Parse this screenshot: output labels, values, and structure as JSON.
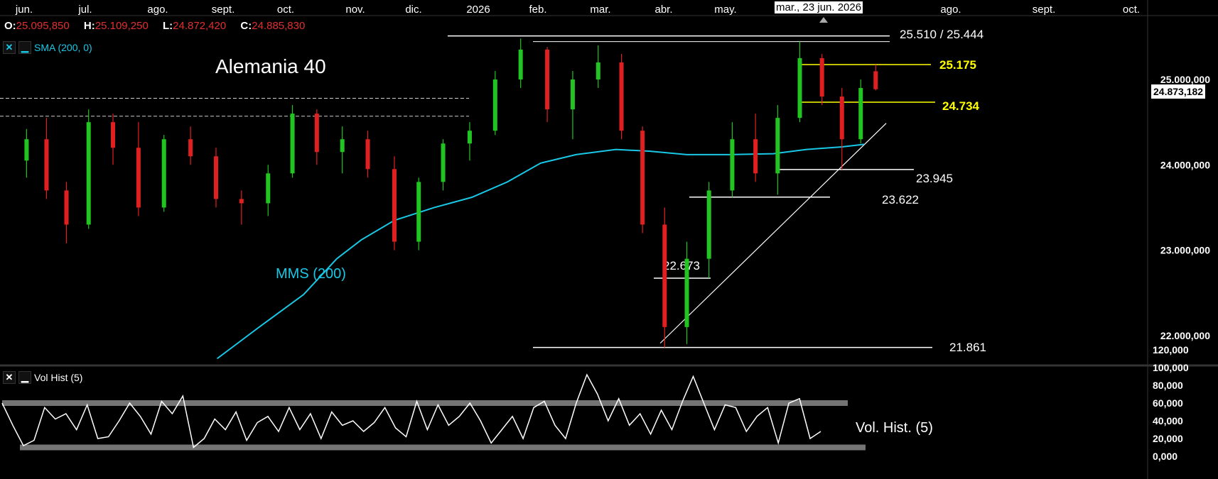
{
  "ohlc": {
    "o_label": "O:",
    "o_value": "25.095,850",
    "h_label": "H:",
    "h_value": "25.109,250",
    "l_label": "L:",
    "l_value": "24.872,420",
    "c_label": "C:",
    "c_value": "24.885,830"
  },
  "sma_legend": {
    "close_glyph": "✕",
    "minimize_glyph": "▁",
    "label": "SMA (200, 0)"
  },
  "vol_legend": {
    "close_glyph": "✕",
    "minimize_glyph": "▁",
    "label": "Vol Hist (5)"
  },
  "crosshair_date": "mar., 23 jun. 2026",
  "last_price": "24.873,182",
  "colors": {
    "up": "#22c422",
    "down": "#e02020",
    "sma": "#19c8e6",
    "level_yellow": "#ffff00",
    "background": "#000000",
    "volatility": "#ffffff"
  },
  "chart_data": [
    {
      "type": "candlestick",
      "title": "Alemania 40",
      "x_ticks": [
        "jun.",
        "jul.",
        "ago.",
        "sept.",
        "oct.",
        "nov.",
        "dic.",
        "2026",
        "feb.",
        "mar.",
        "abr.",
        "may.",
        "mar., 23 jun. 2026",
        "ago.",
        "sept.",
        "oct."
      ],
      "y_ticks": [
        "25.000,000",
        "24.000,000",
        "23.000,000",
        "22.000,000"
      ],
      "ylim": [
        21800,
        25600
      ],
      "series": [
        {
          "name": "SMA (200, 0)",
          "label": "MMS (200)",
          "points": [
            {
              "x": "2025-09-01",
              "y": 21730
            },
            {
              "x": "2025-09-20",
              "y": 22100
            },
            {
              "x": "2025-10-10",
              "y": 22480
            },
            {
              "x": "2025-10-25",
              "y": 22900
            },
            {
              "x": "2025-11-05",
              "y": 23120
            },
            {
              "x": "2025-11-20",
              "y": 23350
            },
            {
              "x": "2025-12-08",
              "y": 23500
            },
            {
              "x": "2025-12-25",
              "y": 23620
            },
            {
              "x": "2026-01-10",
              "y": 23800
            },
            {
              "x": "2026-01-25",
              "y": 24020
            },
            {
              "x": "2026-02-10",
              "y": 24120
            },
            {
              "x": "2026-02-28",
              "y": 24180
            },
            {
              "x": "2026-03-15",
              "y": 24160
            },
            {
              "x": "2026-04-01",
              "y": 24120
            },
            {
              "x": "2026-04-20",
              "y": 24120
            },
            {
              "x": "2026-05-10",
              "y": 24130
            },
            {
              "x": "2026-05-25",
              "y": 24180
            },
            {
              "x": "2026-06-10",
              "y": 24210
            },
            {
              "x": "2026-06-20",
              "y": 24240
            }
          ]
        }
      ],
      "candles": [
        {
          "x": "2025-06-02",
          "o": 24050,
          "h": 24420,
          "l": 23850,
          "c": 24300
        },
        {
          "x": "2025-06-12",
          "o": 24300,
          "h": 24550,
          "l": 23600,
          "c": 23700
        },
        {
          "x": "2025-06-20",
          "o": 23700,
          "h": 23800,
          "l": 23080,
          "c": 23300
        },
        {
          "x": "2025-06-30",
          "o": 23300,
          "h": 24650,
          "l": 23250,
          "c": 24500
        },
        {
          "x": "2025-07-10",
          "o": 24500,
          "h": 24600,
          "l": 24000,
          "c": 24200
        },
        {
          "x": "2025-07-22",
          "o": 24200,
          "h": 24500,
          "l": 23400,
          "c": 23500
        },
        {
          "x": "2025-08-02",
          "o": 23500,
          "h": 24350,
          "l": 23450,
          "c": 24300
        },
        {
          "x": "2025-08-14",
          "o": 24300,
          "h": 24450,
          "l": 24000,
          "c": 24100
        },
        {
          "x": "2025-08-26",
          "o": 24100,
          "h": 24200,
          "l": 23500,
          "c": 23600
        },
        {
          "x": "2025-09-06",
          "o": 23600,
          "h": 23700,
          "l": 23300,
          "c": 23550
        },
        {
          "x": "2025-09-18",
          "o": 23550,
          "h": 24000,
          "l": 23400,
          "c": 23900
        },
        {
          "x": "2025-09-30",
          "o": 23900,
          "h": 24700,
          "l": 23850,
          "c": 24600
        },
        {
          "x": "2025-10-10",
          "o": 24600,
          "h": 24650,
          "l": 24000,
          "c": 24150
        },
        {
          "x": "2025-10-22",
          "o": 24150,
          "h": 24450,
          "l": 23900,
          "c": 24300
        },
        {
          "x": "2025-11-02",
          "o": 24300,
          "h": 24400,
          "l": 23850,
          "c": 23950
        },
        {
          "x": "2025-11-14",
          "o": 23950,
          "h": 24100,
          "l": 23000,
          "c": 23100
        },
        {
          "x": "2025-11-26",
          "o": 23100,
          "h": 23850,
          "l": 23000,
          "c": 23800
        },
        {
          "x": "2025-12-06",
          "o": 23800,
          "h": 24300,
          "l": 23700,
          "c": 24250
        },
        {
          "x": "2025-12-18",
          "o": 24250,
          "h": 24500,
          "l": 24050,
          "c": 24400
        },
        {
          "x": "2025-12-30",
          "o": 24400,
          "h": 25100,
          "l": 24350,
          "c": 25000
        },
        {
          "x": "2026-01-10",
          "o": 25000,
          "h": 25480,
          "l": 24900,
          "c": 25350
        },
        {
          "x": "2026-01-22",
          "o": 25350,
          "h": 25380,
          "l": 24500,
          "c": 24650
        },
        {
          "x": "2026-02-03",
          "o": 24650,
          "h": 25100,
          "l": 24300,
          "c": 25000
        },
        {
          "x": "2026-02-14",
          "o": 25000,
          "h": 25400,
          "l": 24900,
          "c": 25200
        },
        {
          "x": "2026-02-26",
          "o": 25200,
          "h": 25300,
          "l": 24300,
          "c": 24400
        },
        {
          "x": "2026-03-07",
          "o": 24400,
          "h": 24450,
          "l": 23200,
          "c": 23300
        },
        {
          "x": "2026-03-17",
          "o": 23300,
          "h": 23500,
          "l": 21861,
          "c": 22100
        },
        {
          "x": "2026-03-27",
          "o": 22100,
          "h": 23100,
          "l": 21900,
          "c": 22900
        },
        {
          "x": "2026-04-06",
          "o": 22900,
          "h": 23800,
          "l": 22673,
          "c": 23700
        },
        {
          "x": "2026-04-16",
          "o": 23700,
          "h": 24500,
          "l": 23622,
          "c": 24300
        },
        {
          "x": "2026-04-27",
          "o": 24300,
          "h": 24600,
          "l": 23800,
          "c": 23900
        },
        {
          "x": "2026-05-07",
          "o": 23900,
          "h": 24700,
          "l": 23650,
          "c": 24550
        },
        {
          "x": "2026-05-17",
          "o": 24550,
          "h": 25444,
          "l": 24500,
          "c": 25250
        },
        {
          "x": "2026-05-27",
          "o": 25250,
          "h": 25300,
          "l": 24700,
          "c": 24800
        },
        {
          "x": "2026-06-06",
          "o": 24800,
          "h": 24900,
          "l": 23945,
          "c": 24300
        },
        {
          "x": "2026-06-14",
          "o": 24300,
          "h": 25000,
          "l": 24250,
          "c": 24900
        },
        {
          "x": "2026-06-23",
          "o": 25095.85,
          "h": 25175,
          "l": 24872.42,
          "c": 24885.83
        }
      ],
      "levels": [
        {
          "label": "25.510 / 25.444",
          "value": 25510
        },
        {
          "label": "25.175",
          "value": 25175,
          "color": "yellow"
        },
        {
          "label": "24.734",
          "value": 24734,
          "color": "yellow"
        },
        {
          "label": "23.945",
          "value": 23945
        },
        {
          "label": "23.622",
          "value": 23622
        },
        {
          "label": "22.673",
          "value": 22673
        },
        {
          "label": "21.861",
          "value": 21861
        }
      ],
      "dashed_levels": [
        24780,
        24570
      ],
      "trendline": {
        "from": {
          "x": "2026-03-20",
          "y": 21861
        },
        "to": {
          "x": "2026-06-30",
          "y": 24570
        }
      }
    },
    {
      "type": "line",
      "series_label": "Vol. Hist. (5)",
      "y_ticks": [
        "120,000",
        "100,000",
        "80,000",
        "60,000",
        "40,000",
        "20,000",
        "0,000"
      ],
      "ylim": [
        0,
        120
      ],
      "bands": [
        60,
        10
      ],
      "values": [
        60,
        35,
        12,
        18,
        55,
        42,
        48,
        30,
        58,
        20,
        22,
        40,
        60,
        45,
        25,
        62,
        48,
        68,
        10,
        20,
        42,
        30,
        50,
        18,
        38,
        45,
        28,
        55,
        30,
        48,
        20,
        50,
        35,
        40,
        28,
        38,
        55,
        32,
        22,
        62,
        30,
        58,
        35,
        45,
        60,
        40,
        15,
        30,
        45,
        20,
        55,
        62,
        35,
        20,
        60,
        92,
        70,
        40,
        65,
        35,
        48,
        25,
        52,
        30,
        62,
        90,
        60,
        30,
        58,
        55,
        28,
        45,
        55,
        15,
        60,
        65,
        20,
        28
      ]
    }
  ]
}
